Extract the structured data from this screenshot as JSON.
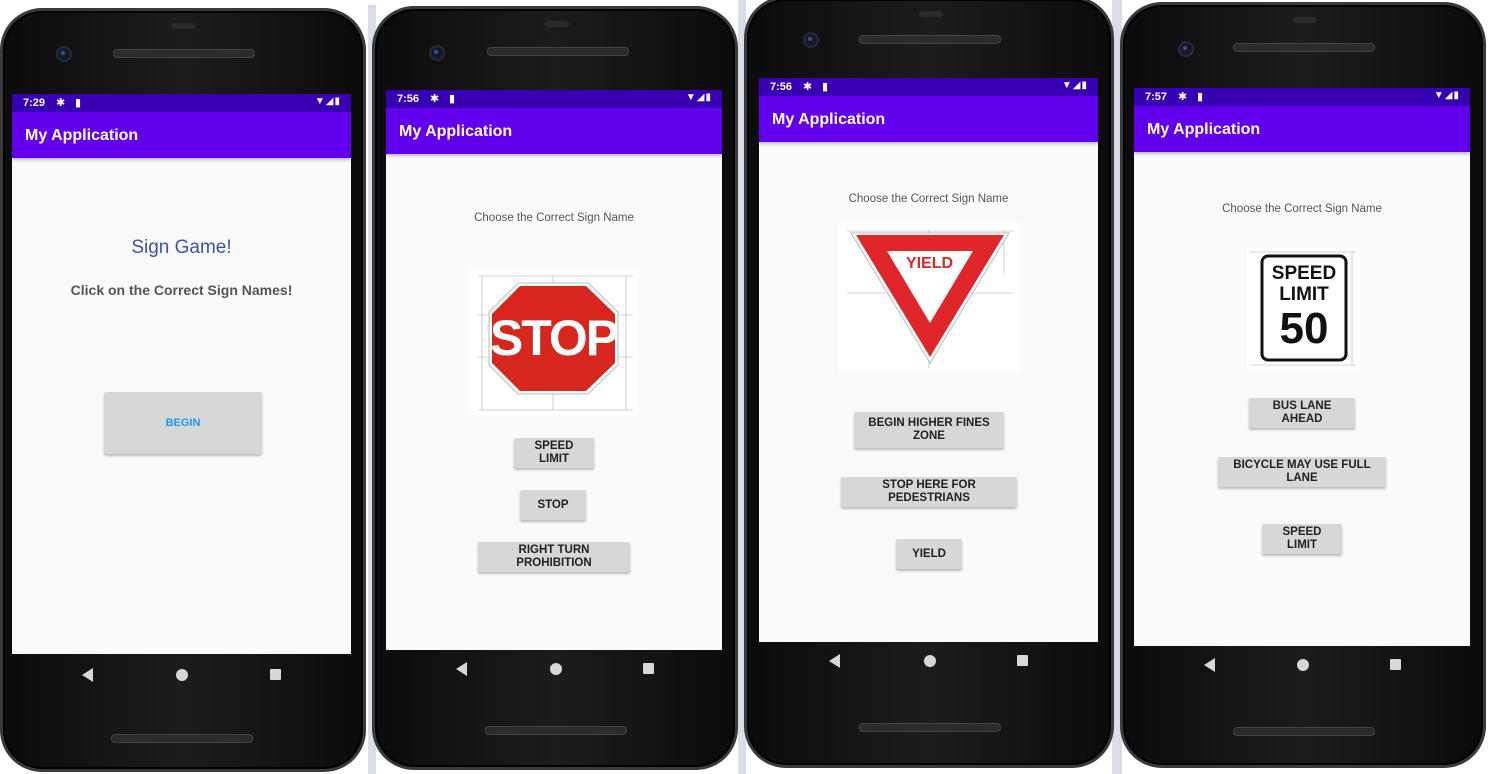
{
  "app": {
    "title": "My Application"
  },
  "colors": {
    "status_bar": "#3700b3",
    "app_bar": "#6200ee",
    "button_bg": "#d6d7d7",
    "begin_text": "#2196f3",
    "title_text": "#3f51b5"
  },
  "phones": [
    {
      "time": "7:29",
      "heading": "Sign Game!",
      "subheading": "Click on the Correct Sign Names!",
      "begin_label": "BEGIN"
    },
    {
      "time": "7:56",
      "prompt": "Choose the Correct Sign Name",
      "sign_text": "STOP",
      "options": [
        "SPEED LIMIT",
        "STOP",
        "RIGHT TURN PROHIBITION"
      ]
    },
    {
      "time": "7:56",
      "prompt": "Choose the Correct Sign Name",
      "sign_text": "YIELD",
      "options": [
        "BEGIN HIGHER FINES ZONE",
        "STOP HERE FOR PEDESTRIANS",
        "YIELD"
      ]
    },
    {
      "time": "7:57",
      "prompt": "Choose the Correct Sign Name",
      "sign_text": {
        "line1": "SPEED",
        "line2": "LIMIT",
        "line3": "50"
      },
      "options": [
        "BUS LANE AHEAD",
        "BICYCLE MAY USE FULL LANE",
        "SPEED LIMIT"
      ]
    }
  ],
  "icons": [
    "gear-icon",
    "sd-card-icon",
    "wifi-icon",
    "signal-icon",
    "battery-icon",
    "back-icon",
    "home-icon",
    "recents-icon"
  ]
}
